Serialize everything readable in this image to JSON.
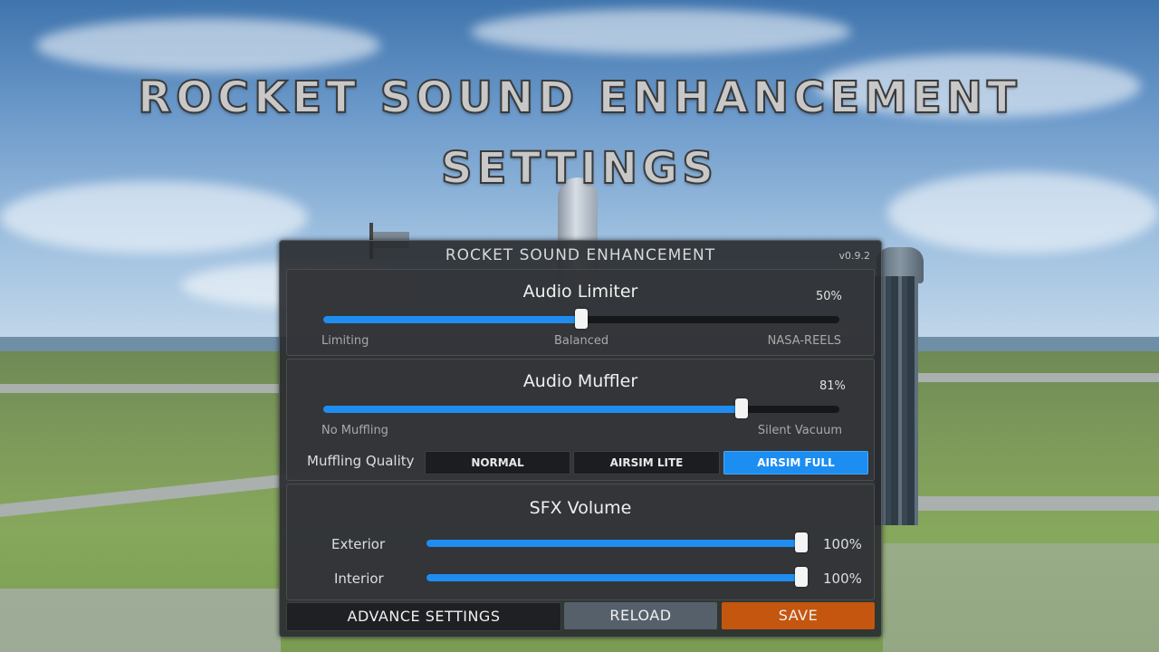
{
  "overlay_title": {
    "line1": "ROCKET SOUND ENHANCEMENT",
    "line2": "SETTINGS"
  },
  "panel": {
    "title": "ROCKET SOUND ENHANCEMENT",
    "version": "v0.9.2"
  },
  "audio_limiter": {
    "title": "Audio Limiter",
    "percent_label": "50%",
    "value": 0.5,
    "left_label": "Limiting",
    "center_label": "Balanced",
    "right_label": "NASA-REELS"
  },
  "audio_muffler": {
    "title": "Audio Muffler",
    "percent_label": "81%",
    "value": 0.81,
    "left_label": "No Muffling",
    "right_label": "Silent Vacuum",
    "quality_label": "Muffling Quality",
    "quality_options": [
      "NORMAL",
      "AIRSIM LITE",
      "AIRSIM FULL"
    ],
    "quality_selected": "AIRSIM FULL"
  },
  "sfx_volume": {
    "title": "SFX Volume",
    "exterior_label": "Exterior",
    "exterior_percent": "100%",
    "exterior_value": 1.0,
    "interior_label": "Interior",
    "interior_percent": "100%",
    "interior_value": 1.0
  },
  "footer": {
    "advance_label": "ADVANCE SETTINGS",
    "reload_label": "RELOAD",
    "save_label": "SAVE"
  },
  "colors": {
    "accent_blue": "#1f8df0",
    "save_orange": "#c4560f",
    "reload_gray": "#56606b",
    "advance_dark": "#1f2023"
  }
}
